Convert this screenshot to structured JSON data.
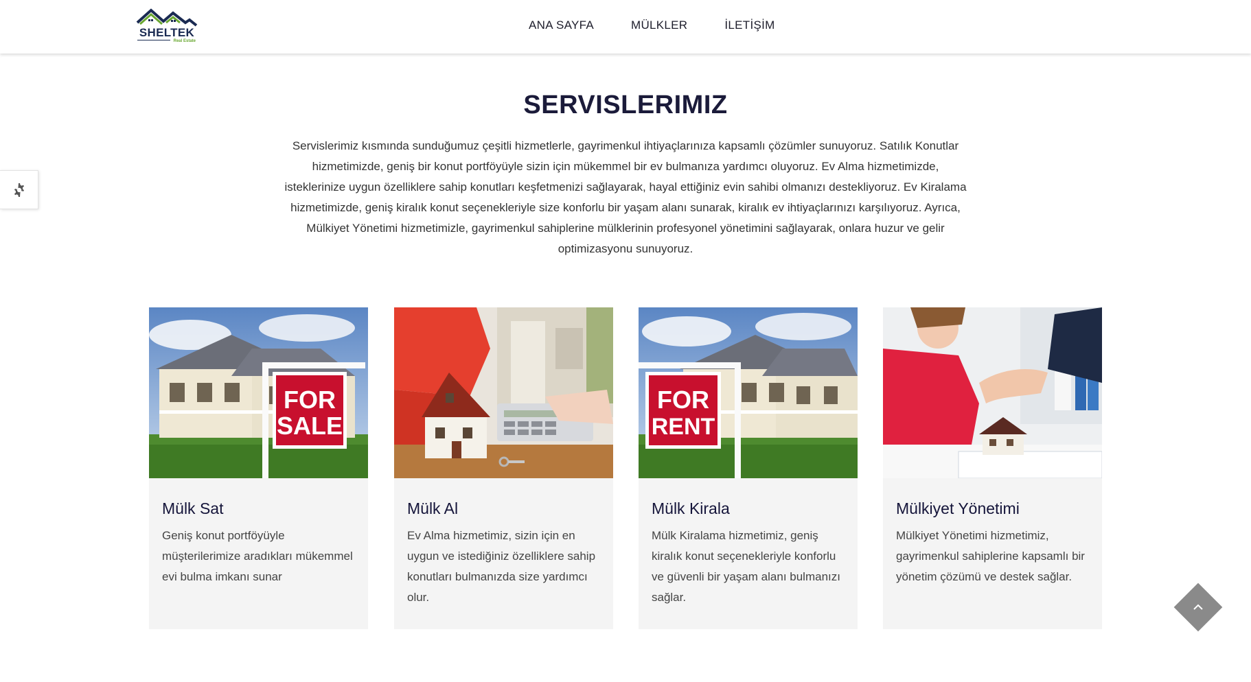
{
  "brand": {
    "logo_text": "SHELTEK",
    "logo_sub": "Real Estate"
  },
  "nav": {
    "items": [
      {
        "label": "ANA SAYFA"
      },
      {
        "label": "MÜLKLER"
      },
      {
        "label": "İLETİŞİM"
      }
    ]
  },
  "section": {
    "title": "SERVISLERIMIZ",
    "description": "Servislerimiz kısmında sunduğumuz çeşitli hizmetlerle, gayrimenkul ihtiyaçlarınıza kapsamlı çözümler sunuyoruz. Satılık Konutlar hizmetimizde, geniş bir konut portföyüyle sizin için mükemmel bir ev bulmanıza yardımcı oluyoruz. Ev Alma hizmetimizde, isteklerinize uygun özelliklere sahip konutları keşfetmenizi sağlayarak, hayal ettiğiniz evin sahibi olmanızı destekliyoruz. Ev Kiralama hizmetimizde, geniş kiralık konut seçenekleriyle size konforlu bir yaşam alanı sunarak, kiralık ev ihtiyaçlarınızı karşılıyoruz. Ayrıca, Mülkiyet Yönetimi hizmetimizle, gayrimenkul sahiplerine mülklerinin profesyonel yönetimini sağlayarak, onlara huzur ve gelir optimizasyonu sunuyoruz."
  },
  "cards": [
    {
      "title": "Mülk Sat",
      "text": "Geniş konut portföyüyle müşterilerimize aradıkları mükemmel evi bulma imkanı sunar",
      "sign_line1": "FOR",
      "sign_line2": "SALE"
    },
    {
      "title": "Mülk Al",
      "text": "Ev Alma hizmetimiz, sizin için en uygun ve istediğiniz özelliklere sahip konutları bulmanızda size yardımcı olur."
    },
    {
      "title": "Mülk Kirala",
      "text": "Mülk Kiralama hizmetimiz, geniş kiralık konut seçenekleriyle konforlu ve güvenli bir yaşam alanı bulmanızı sağlar.",
      "sign_line1": "FOR",
      "sign_line2": "RENT"
    },
    {
      "title": "Mülkiyet Yönetimi",
      "text": "Mülkiyet Yönetimi hizmetimiz, gayrimenkul sahiplerine kapsamlı bir yönetim çözümü ve destek sağlar."
    }
  ],
  "colors": {
    "title": "#1b1b3a",
    "card_bg": "#f4f4f4",
    "sign_red": "#c8102e",
    "logo_green": "#6aa832",
    "scroll_top": "#8a8a8a"
  },
  "icons": {
    "settings": "gear-icon",
    "scroll_top": "chevron-up-icon"
  }
}
